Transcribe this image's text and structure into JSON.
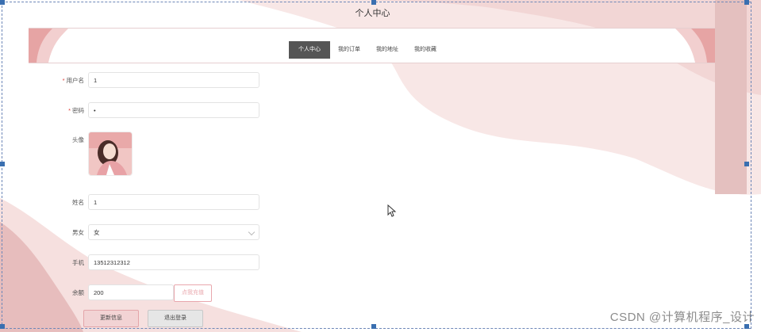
{
  "app": {
    "title": "个人中心"
  },
  "nav": {
    "tabs": [
      {
        "label": "个人中心",
        "active": true
      },
      {
        "label": "我的订单",
        "active": false
      },
      {
        "label": "我的地址",
        "active": false
      },
      {
        "label": "我的收藏",
        "active": false
      }
    ]
  },
  "form": {
    "username": {
      "label": "用户名",
      "required": "*",
      "value": "1"
    },
    "password": {
      "label": "密码",
      "required": "*",
      "value": "•"
    },
    "avatar": {
      "label": "头像"
    },
    "name": {
      "label": "姓名",
      "value": "1"
    },
    "gender": {
      "label": "男女",
      "value": "女"
    },
    "phone": {
      "label": "手机",
      "value": "13512312312"
    },
    "balance": {
      "label": "余额",
      "value": "200",
      "recharge_label": "点我充值"
    }
  },
  "buttons": {
    "update": "更新信息",
    "logout": "退出登录"
  },
  "watermark": "CSDN @计算机程序_设计",
  "colors": {
    "accent_pink": "#e9a7ad",
    "tab_active": "#555555",
    "wave": "#f3dcdc"
  }
}
